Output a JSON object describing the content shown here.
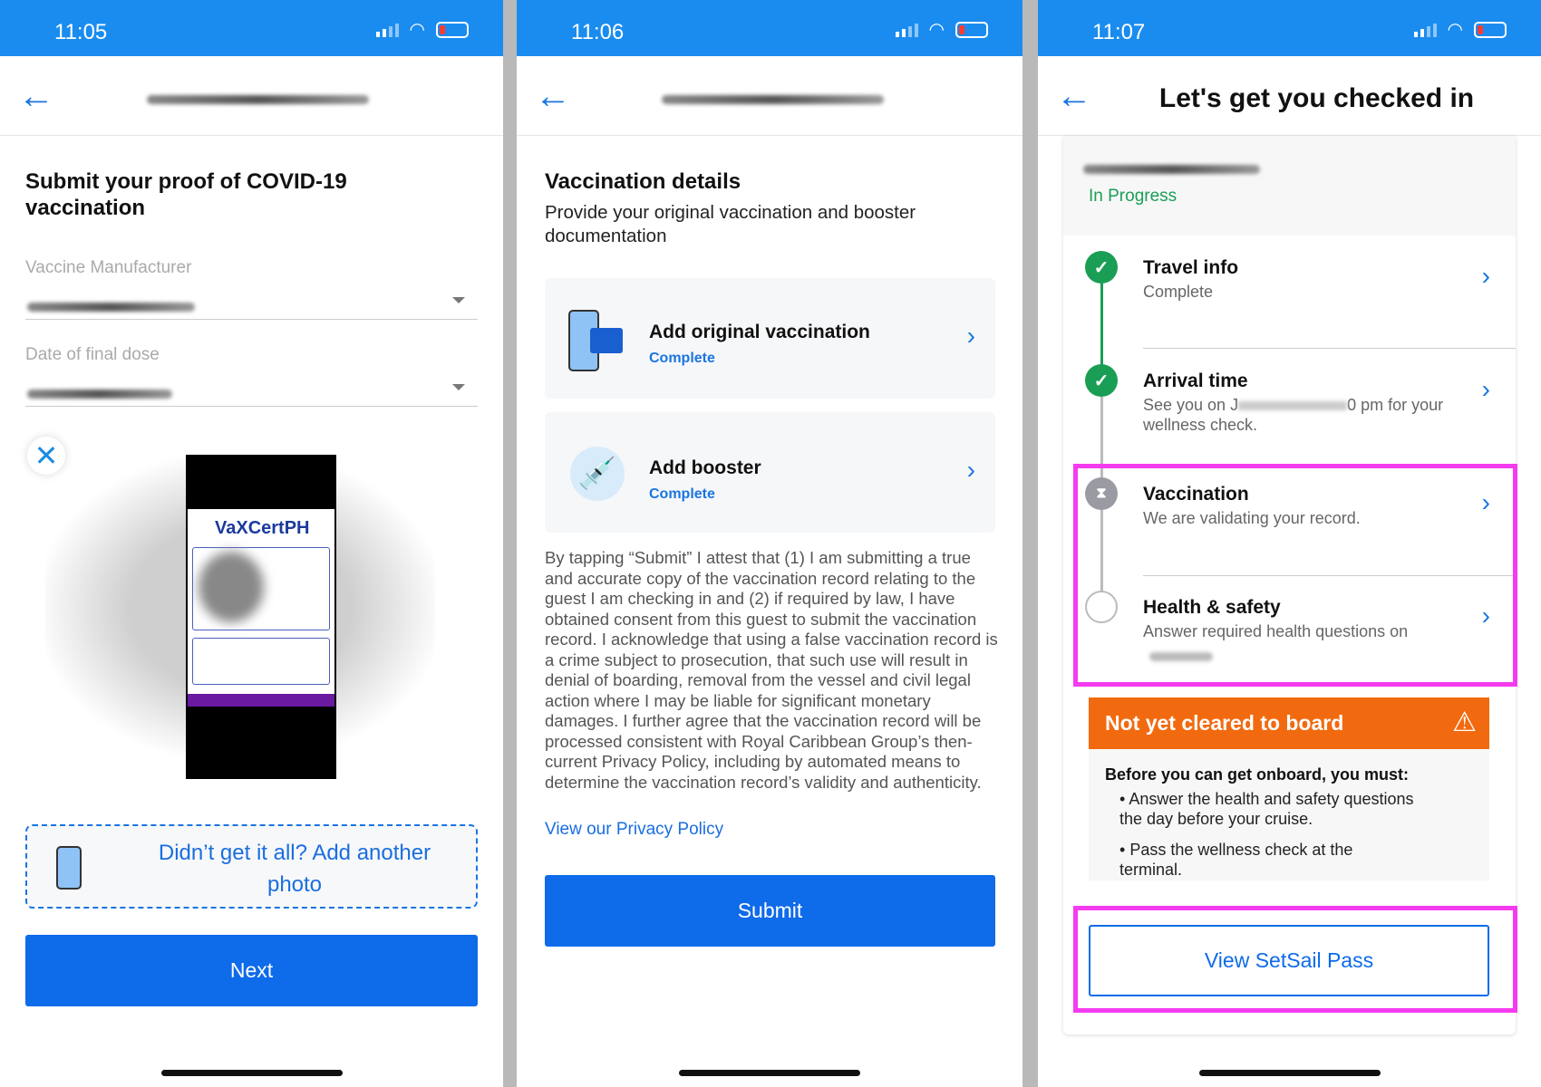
{
  "panels": [
    {
      "time": "11:05"
    },
    {
      "time": "11:06"
    },
    {
      "time": "11:07"
    }
  ],
  "screen1": {
    "title": "Submit your proof of COVID-19 vaccination",
    "manufacturer_label": "Vaccine Manufacturer",
    "date_label": "Date of final dose",
    "certificate_logo": "VaXCertPH",
    "add_photo": "Didn’t get it all? Add another photo",
    "next": "Next"
  },
  "screen2": {
    "title": "Vaccination details",
    "subtitle": "Provide your original vaccination and booster documentation",
    "cards": [
      {
        "title": "Add original vaccination",
        "status": "Complete",
        "icon": "phone-card-icon"
      },
      {
        "title": "Add booster",
        "status": "Complete",
        "icon": "syringe-icon"
      }
    ],
    "attestation": "By tapping “Submit” I attest that (1) I am submitting a true and accurate copy of the vaccination record relating to the guest I am checking in and (2) if required by law, I have obtained consent from this guest to submit the vaccination record. I acknowledge that using a false vaccination record is a crime subject to prosecution, that such use will result in denial of boarding, removal from the vessel and civil legal action where I may be liable for significant monetary damages. I further agree that the vaccination record will be processed consistent with Royal Caribbean Group’s then-current Privacy Policy, including by automated means to determine the vaccination record’s validity and authenticity.",
    "privacy_link": "View our Privacy Policy",
    "submit": "Submit"
  },
  "screen3": {
    "title": "Let's get you checked in",
    "status": "In Progress",
    "steps": [
      {
        "title": "Travel info",
        "sub": "Complete",
        "state": "complete"
      },
      {
        "title": "Arrival time",
        "sub_a": "See you on J",
        "sub_b": "0 pm for your wellness check.",
        "state": "complete"
      },
      {
        "title": "Vaccination",
        "sub": "We are validating your record.",
        "state": "pending"
      },
      {
        "title": "Health & safety",
        "sub": "Answer required health questions on",
        "state": "todo"
      }
    ],
    "alert": {
      "title": "Not yet cleared to board",
      "intro": "Before you can get onboard, you must:",
      "items": [
        "Answer the health and safety questions the day before your cruise.",
        "Pass the wellness check at the terminal."
      ]
    },
    "pass_button": "View SetSail Pass"
  },
  "colors": {
    "primary": "#0e6bea",
    "status_bar": "#1a8cf0",
    "success": "#1a9e55",
    "warning": "#f26a0f",
    "highlight": "#f53bf0"
  }
}
